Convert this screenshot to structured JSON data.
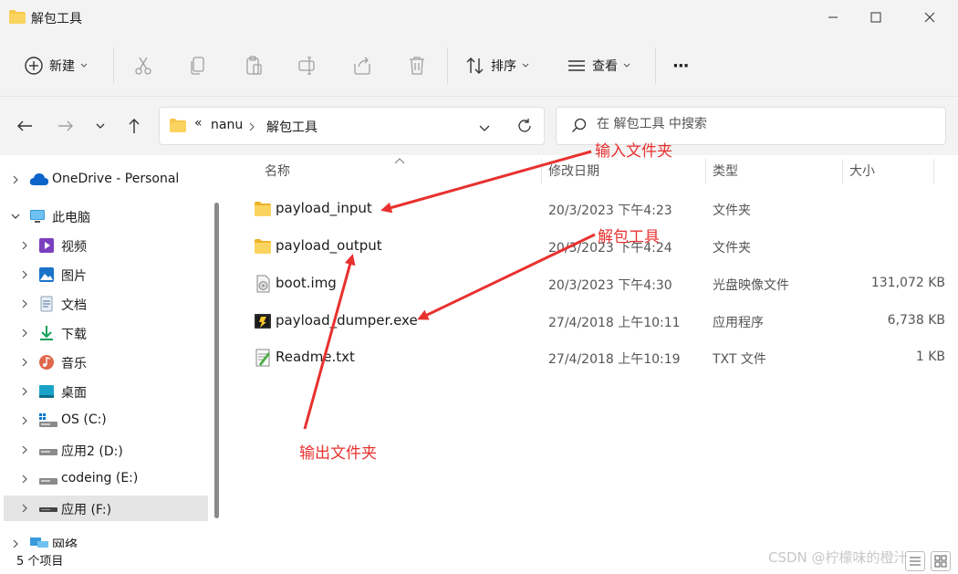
{
  "window": {
    "title": "解包工具"
  },
  "toolbar": {
    "new_label": "新建",
    "sort_label": "排序",
    "view_label": "查看",
    "more_label": "···"
  },
  "address": {
    "overflow": "«",
    "crumbs": [
      "nanu",
      "解包工具"
    ]
  },
  "search": {
    "placeholder": "在 解包工具 中搜索"
  },
  "sidebar": {
    "items": [
      {
        "label": "OneDrive - Personal",
        "icon": "cloud-icon"
      },
      {
        "label": "此电脑",
        "icon": "computer-icon"
      },
      {
        "label": "视频",
        "icon": "video-icon"
      },
      {
        "label": "图片",
        "icon": "picture-icon"
      },
      {
        "label": "文档",
        "icon": "document-icon"
      },
      {
        "label": "下载",
        "icon": "download-icon"
      },
      {
        "label": "音乐",
        "icon": "music-icon"
      },
      {
        "label": "桌面",
        "icon": "desktop-icon"
      },
      {
        "label": "OS (C:)",
        "icon": "drive-c-icon"
      },
      {
        "label": "应用2 (D:)",
        "icon": "drive-icon"
      },
      {
        "label": "codeing (E:)",
        "icon": "drive-icon"
      },
      {
        "label": "应用 (F:)",
        "icon": "drive-icon"
      },
      {
        "label": "网络",
        "icon": "network-icon"
      }
    ]
  },
  "columns": {
    "name": "名称",
    "date": "修改日期",
    "type": "类型",
    "size": "大小"
  },
  "files": [
    {
      "name": "payload_input",
      "date": "20/3/2023 下午4:23",
      "type": "文件夹",
      "size": "",
      "icon": "folder-icon"
    },
    {
      "name": "payload_output",
      "date": "20/3/2023 下午4:24",
      "type": "文件夹",
      "size": "",
      "icon": "folder-icon"
    },
    {
      "name": "boot.img",
      "date": "20/3/2023 下午4:30",
      "type": "光盘映像文件",
      "size": "131,072 KB",
      "icon": "disc-image-icon"
    },
    {
      "name": "payload_dumper.exe",
      "date": "27/4/2018 上午10:11",
      "type": "应用程序",
      "size": "6,738 KB",
      "icon": "exe-icon"
    },
    {
      "name": "Readme.txt",
      "date": "27/4/2018 上午10:19",
      "type": "TXT 文件",
      "size": "1 KB",
      "icon": "text-file-icon"
    }
  ],
  "status": {
    "item_count": "5 个项目"
  },
  "annotations": {
    "input_folder": "输入文件夹",
    "tool": "解包工具",
    "output_folder": "输出文件夹"
  },
  "watermark": "CSDN @柠檬味的橙汁",
  "colors": {
    "annotation_red": "#e8312f",
    "folder_yellow": "#f8c84a",
    "accent_blue": "#0067c0"
  }
}
